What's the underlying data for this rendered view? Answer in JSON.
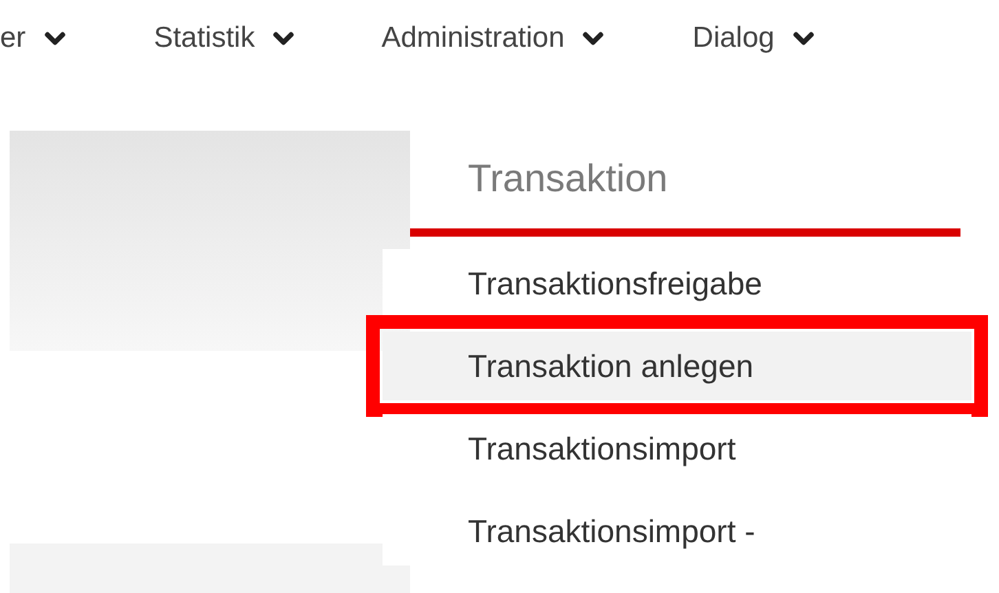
{
  "menu_bar": [
    {
      "label": "er"
    },
    {
      "label": "Statistik"
    },
    {
      "label": "Administration"
    },
    {
      "label": "Dialog"
    }
  ],
  "dropdown": {
    "heading": "Transaktion",
    "items": [
      {
        "label": "Transaktionsfreigabe",
        "selected": false
      },
      {
        "label": "Transaktion anlegen",
        "selected": true
      },
      {
        "label": "Transaktionsimport",
        "selected": false
      },
      {
        "label": "Transaktionsimport -",
        "selected": false
      }
    ]
  }
}
